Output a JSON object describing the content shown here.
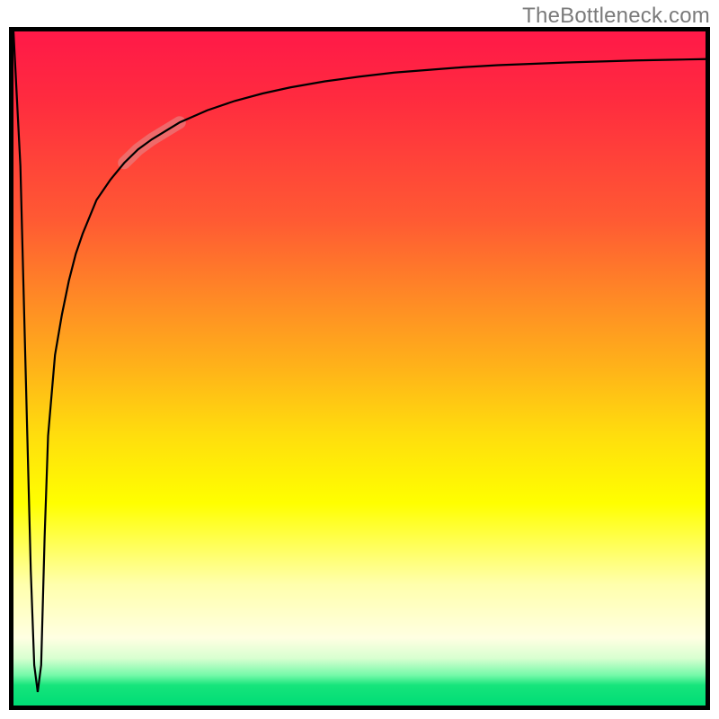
{
  "branding": {
    "watermark": "TheBottleneck.com"
  },
  "chart_data": {
    "type": "line",
    "title": "",
    "xlabel": "",
    "ylabel": "",
    "xlim": [
      0,
      100
    ],
    "ylim": [
      0,
      100
    ],
    "grid": false,
    "legend": false,
    "series": [
      {
        "name": "curve",
        "x": [
          0.0,
          1.0,
          2.0,
          2.5,
          3.0,
          3.5,
          4.0,
          4.5,
          5.0,
          6.0,
          7.0,
          8.0,
          9.0,
          10.0,
          12.0,
          14.0,
          16.0,
          18.0,
          20.0,
          24.0,
          28.0,
          32.0,
          36.0,
          40.0,
          45.0,
          50.0,
          55.0,
          60.0,
          65.0,
          70.0,
          75.0,
          80.0,
          85.0,
          90.0,
          95.0,
          100.0
        ],
        "values": [
          100.0,
          80.0,
          40.0,
          20.0,
          6.0,
          2.0,
          6.0,
          25.0,
          40.0,
          52.0,
          58.0,
          63.0,
          67.0,
          70.0,
          75.0,
          78.0,
          80.5,
          82.5,
          84.0,
          86.5,
          88.3,
          89.7,
          90.8,
          91.7,
          92.6,
          93.3,
          93.9,
          94.3,
          94.7,
          95.0,
          95.2,
          95.4,
          95.55,
          95.7,
          95.8,
          95.9
        ]
      }
    ],
    "highlight_segment": {
      "series": "curve",
      "x_start": 16.0,
      "x_end": 24.0
    },
    "background_gradient": {
      "stops": [
        {
          "pos": 0.0,
          "color": "#ff1948"
        },
        {
          "pos": 0.4,
          "color": "#ff8b25"
        },
        {
          "pos": 0.7,
          "color": "#ffff00"
        },
        {
          "pos": 0.9,
          "color": "#ffffe2"
        },
        {
          "pos": 0.97,
          "color": "#16e47b"
        },
        {
          "pos": 1.0,
          "color": "#00dd76"
        }
      ]
    }
  }
}
